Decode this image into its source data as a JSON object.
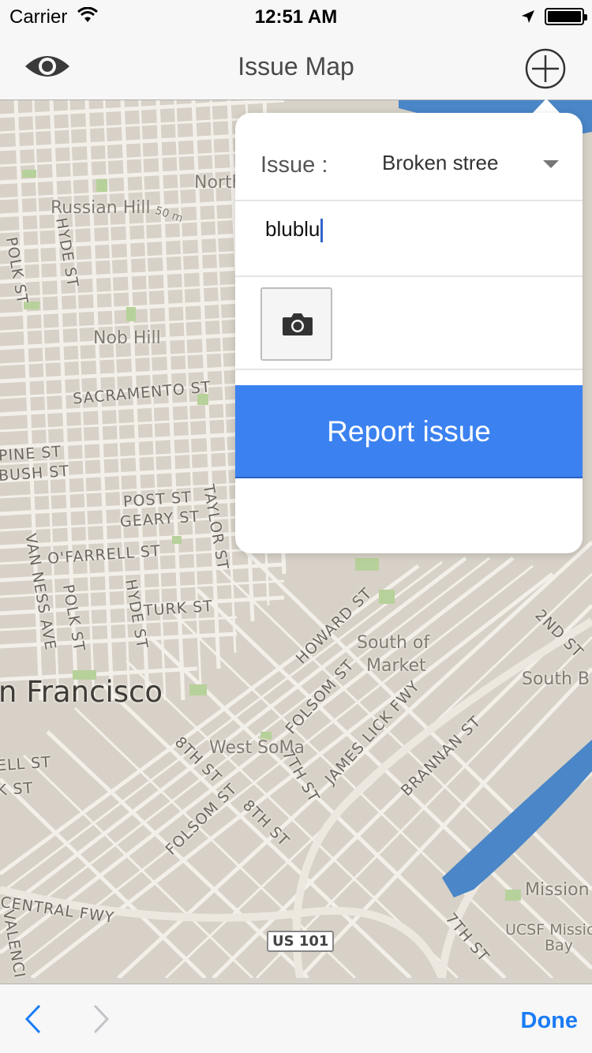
{
  "status_bar": {
    "carrier": "Carrier",
    "time": "12:51 AM"
  },
  "nav": {
    "title": "Issue Map",
    "left_icon": "eye-icon",
    "right_icon": "plus-circle-icon"
  },
  "map": {
    "streets": [
      "HYDE ST",
      "POLK ST",
      "SACRAMENTO ST",
      "PINE ST",
      "BUSH ST",
      "POST ST",
      "GEARY ST",
      "TAYLOR ST",
      "O'FARRELL ST",
      "VAN NESS AVE",
      "POLK ST",
      "HYDE ST",
      "TURK ST",
      "HOWARD ST",
      "FOLSOM ST",
      "JAMES LICK FWY",
      "8TH ST",
      "7TH ST",
      "FOLSOM ST",
      "8TH ST",
      "BRANNAN ST",
      "2ND ST",
      "ELL ST",
      "K ST",
      "CENTRAL FWY",
      "VALENCIA",
      "7TH ST"
    ],
    "neighborhoods": [
      "Russian Hill",
      "Nob Hill",
      "North",
      "South of",
      "Market",
      "West SoMa",
      "South B",
      "Mission",
      "UCSF Missio",
      "Bay"
    ],
    "city": "n Francisco",
    "scale_label": "50 m",
    "highway_shield": "US 101"
  },
  "popover": {
    "issue_label": "Issue :",
    "issue_value": "Broken stree",
    "text_value": "blublu",
    "camera_icon": "camera-icon",
    "report_label": "Report issue"
  },
  "toolbar": {
    "back_icon": "chevron-left-icon",
    "forward_icon": "chevron-right-icon",
    "done_label": "Done"
  },
  "colors": {
    "accent": "#1a7cf5",
    "report_button": "#3b82f0",
    "map_base": "#d7d1c7"
  }
}
